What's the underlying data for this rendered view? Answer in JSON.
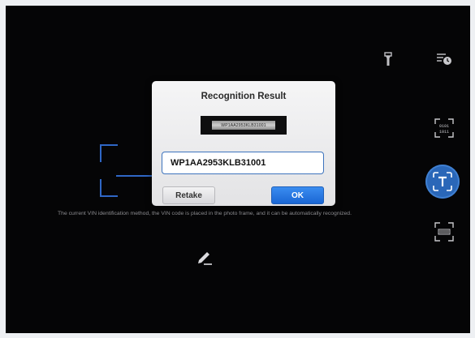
{
  "dialog": {
    "title": "Recognition Result",
    "vin_image_text": "WP1AA2953KLB31001",
    "vin_value": "WP1AA2953KLB31001",
    "retake_label": "Retake",
    "ok_label": "OK"
  },
  "scanner": {
    "hint": "The current VIN identification method, the VIN code is placed in the photo frame, and it can be automatically recognized."
  },
  "icons": {
    "flashlight": "flashlight-icon",
    "history": "history-icon",
    "barcode_mode": "barcode-scan-icon",
    "text_mode": "text-recognition-icon",
    "vin_mode": "vin-scan-icon",
    "edit": "edit-pencil-icon"
  },
  "colors": {
    "accent": "#2a67b8",
    "ok_button": "#1a66d4",
    "frame": "#2f67c6",
    "background": "#050506"
  }
}
